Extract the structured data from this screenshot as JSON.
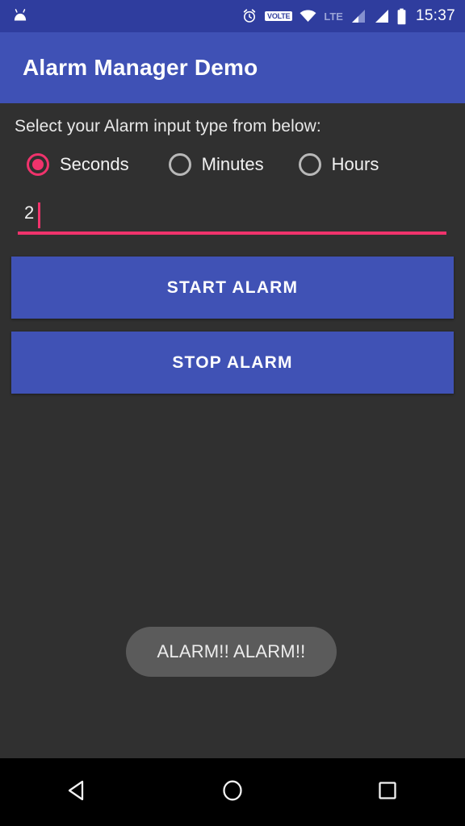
{
  "status_bar": {
    "notification_icon": "android-robot-icon",
    "icons": [
      {
        "name": "alarm-clock-icon",
        "label": "alarm"
      },
      {
        "name": "volte-icon",
        "label": "VOLTE"
      },
      {
        "name": "wifi-icon",
        "label": "wifi"
      },
      {
        "name": "lte-icon",
        "label": "LTE"
      },
      {
        "name": "signal-sim1-icon",
        "label": "signal 1"
      },
      {
        "name": "signal-sim2-icon",
        "label": "signal 2"
      },
      {
        "name": "battery-icon",
        "label": "battery"
      }
    ],
    "volte_label": "VOLTE",
    "lte_label": "LTE",
    "clock": "15:37",
    "background_color": "#2F3D9E"
  },
  "app_bar": {
    "title": "Alarm Manager Demo",
    "background_color": "#3F51B5"
  },
  "main": {
    "instruction": "Select your Alarm input type from below:",
    "radio_group": {
      "selected": "Seconds",
      "options": [
        {
          "label": "Seconds",
          "checked": true
        },
        {
          "label": "Minutes",
          "checked": false
        },
        {
          "label": "Hours",
          "checked": false
        }
      ]
    },
    "input": {
      "value": "2",
      "placeholder": "",
      "accent_color": "#F0336C",
      "focused": true
    },
    "buttons": [
      {
        "name": "start-alarm-button",
        "label": "START ALARM"
      },
      {
        "name": "stop-alarm-button",
        "label": "STOP ALARM"
      }
    ],
    "start_label": "START ALARM",
    "stop_label": "STOP ALARM",
    "button_color": "#4052B5",
    "background_color": "#303030"
  },
  "toast": {
    "message": "ALARM!! ALARM!!",
    "background_color": "#5B5B5B"
  },
  "nav_bar": {
    "back": "back-button",
    "home": "home-button",
    "recents": "recents-button",
    "background_color": "#000000"
  }
}
